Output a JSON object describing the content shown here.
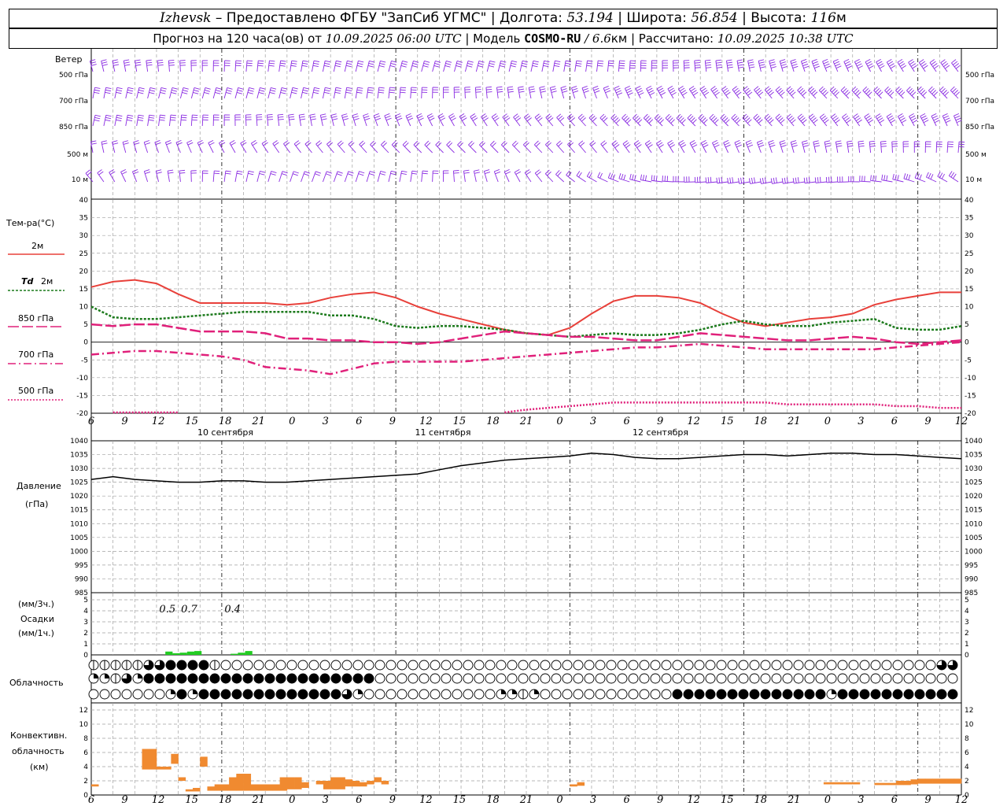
{
  "header": {
    "station": "Izhevsk",
    "dash": " – ",
    "provider": "Предоставлено ФГБУ \"ЗапСиб УГМС\" | Долгота: ",
    "lon": "53.194",
    "lat_label": " | Широта: ",
    "lat": "56.854",
    "alt_label": " | Высота: ",
    "alt": "116",
    "alt_unit": "м",
    "forecast_prefix": "Прогноз на 120 часа(ов) от ",
    "forecast_from": "10.09.2025 06:00 UTC",
    "model_label": " | Модель ",
    "model": "COSMO-RU",
    "model_res": " / 6.6",
    "model_unit": "км",
    "calc_label": " | Рассчитано: ",
    "calc": "10.09.2025 10:38 UTC"
  },
  "labels": {
    "wind": "Ветер",
    "wind_levels": [
      "500 гПа",
      "700 гПа",
      "850 гПа",
      "500 м",
      "10  м"
    ],
    "temp": "Тем-ра(°С)",
    "t2m": "2м",
    "td": "Td",
    "td2m": "2м",
    "t850": "850 гПа",
    "t700": "700 гПа",
    "t500": "500 гПа",
    "pressure": "Давление",
    "pressure_unit": "(гПа)",
    "precip_unit3": "(мм/3ч.)",
    "precip": "Осадки",
    "precip_unit1": "(мм/1ч.)",
    "cloud": "Облачность",
    "conv1": "Конвективн.",
    "conv2": "облачность",
    "conv3": "(км)"
  },
  "colors": {
    "t2m": "#e8403a",
    "td": "#1c7a1c",
    "t850": "#e0207a",
    "t700": "#e0207a",
    "t500": "#e0207a",
    "wind": "#8a2be2",
    "precip": "#22cc22",
    "conv": "#f08a30",
    "grid": "#a0a0a0"
  },
  "chart_data": [
    {
      "type": "line",
      "title": "Тем-ра(°С)",
      "x_ticks": [
        "6",
        "9",
        "12",
        "15",
        "18",
        "21",
        "0",
        "3",
        "6",
        "9",
        "12",
        "15",
        "18",
        "21",
        "0",
        "3",
        "6",
        "9",
        "12",
        "15",
        "18",
        "21",
        "0",
        "3",
        "6",
        "9",
        "12"
      ],
      "date_labels": [
        "10 сентября",
        "11 сентября",
        "12 сентября"
      ],
      "ylim": [
        -20,
        40
      ],
      "yticks": [
        -20,
        -15,
        -10,
        -5,
        0,
        5,
        10,
        15,
        20,
        25,
        30,
        35,
        40
      ],
      "x_hours": [
        0,
        3,
        6,
        9,
        12,
        15,
        18,
        21,
        24,
        27,
        30,
        33,
        36,
        39,
        42,
        45,
        48,
        51,
        54,
        57,
        60,
        63,
        66,
        69,
        72,
        75,
        78,
        81,
        84,
        87,
        90,
        93,
        96,
        99,
        102,
        105,
        108,
        111,
        114,
        117,
        120
      ],
      "series": [
        {
          "name": "2м",
          "values": [
            15.5,
            17,
            17.5,
            16.5,
            13.5,
            11,
            11,
            11,
            11,
            10.5,
            11,
            12.5,
            13.5,
            14,
            12.5,
            10,
            8,
            6.5,
            5,
            3.5,
            2.5,
            2,
            4,
            8,
            11.5,
            13,
            13,
            12.5,
            11,
            8,
            5.5,
            4.5,
            5.5,
            6.5,
            7,
            8,
            10.5,
            12,
            13,
            14,
            14
          ]
        },
        {
          "name": "Td 2м",
          "values": [
            10,
            7,
            6.5,
            6.5,
            7,
            7.5,
            8,
            8.5,
            8.5,
            8.5,
            8.5,
            7.5,
            7.5,
            6.5,
            4.5,
            4,
            4.5,
            4.5,
            4,
            3.5,
            2.5,
            2,
            1.5,
            2,
            2.5,
            2,
            2,
            2.5,
            3.5,
            5,
            6,
            5,
            4.5,
            4.5,
            5.5,
            6,
            6.5,
            4,
            3.5,
            3.5,
            4.5
          ]
        },
        {
          "name": "850 гПа",
          "values": [
            5,
            4.5,
            5,
            5,
            4,
            3,
            3,
            3,
            2.5,
            1,
            1,
            0.5,
            0.5,
            0,
            0,
            -0.5,
            0,
            1,
            2,
            3,
            2.5,
            2,
            1.5,
            1.5,
            1,
            0.5,
            0.5,
            1.5,
            2.5,
            2,
            1.5,
            1,
            0.5,
            0.5,
            1,
            1.5,
            1,
            0,
            -0.5,
            0,
            0.5
          ]
        },
        {
          "name": "700 гПа",
          "values": [
            -3.5,
            -3,
            -2.5,
            -2.5,
            -3,
            -3.5,
            -4,
            -5,
            -7,
            -7.5,
            -8,
            -9,
            -7.5,
            -6,
            -5.5,
            -5.5,
            -5.5,
            -5.5,
            -5,
            -4.5,
            -4,
            -3.5,
            -3,
            -2.5,
            -2,
            -1.5,
            -1.5,
            -1,
            -0.5,
            -1,
            -1.5,
            -2,
            -2,
            -2,
            -2,
            -2,
            -2,
            -1.5,
            -1,
            -0.5,
            0
          ]
        },
        {
          "name": "500 гПа",
          "values": [
            null,
            -20,
            -20,
            -20,
            -20,
            null,
            null,
            null,
            null,
            null,
            null,
            null,
            null,
            null,
            null,
            null,
            null,
            null,
            null,
            -20,
            -19,
            -18.5,
            -18,
            -17.5,
            -17,
            -17,
            -17,
            -17,
            -17,
            -17,
            -17,
            -17,
            -17.5,
            -17.5,
            -17.5,
            -17.5,
            -17.5,
            -18,
            -18,
            -18.5,
            -18.5
          ]
        }
      ]
    },
    {
      "type": "line",
      "title": "Давление",
      "ylabel": "(гПа)",
      "ylim": [
        985,
        1040
      ],
      "yticks": [
        985,
        990,
        995,
        1000,
        1005,
        1010,
        1015,
        1020,
        1025,
        1030,
        1035,
        1040
      ],
      "x_hours": [
        0,
        3,
        6,
        9,
        12,
        15,
        18,
        21,
        24,
        27,
        30,
        33,
        36,
        39,
        42,
        45,
        48,
        51,
        54,
        57,
        60,
        63,
        66,
        69,
        72,
        75,
        78,
        81,
        84,
        87,
        90,
        93,
        96,
        99,
        102,
        105,
        108,
        111,
        114,
        117,
        120
      ],
      "series": [
        {
          "name": "Давление",
          "values": [
            1026,
            1027,
            1026,
            1025.5,
            1025,
            1025,
            1025.5,
            1025.5,
            1025,
            1025,
            1025.5,
            1026,
            1026.5,
            1027,
            1027.5,
            1028,
            1029.5,
            1031,
            1032,
            1033,
            1033.5,
            1034,
            1034.5,
            1035.5,
            1035,
            1034,
            1033.5,
            1033.5,
            1034,
            1034.5,
            1035,
            1035,
            1034.5,
            1035,
            1035.5,
            1035.5,
            1035,
            1035,
            1034.5,
            1034,
            1033.5
          ]
        }
      ]
    },
    {
      "type": "bar",
      "title": "Осадки",
      "ylim": [
        0,
        5
      ],
      "yticks": [
        0,
        1,
        2,
        3,
        4,
        5
      ],
      "annotations": [
        {
          "hour": 10.5,
          "text": "0.5"
        },
        {
          "hour": 13.5,
          "text": "0.7"
        },
        {
          "hour": 19.5,
          "text": "0.4"
        }
      ],
      "hours": [
        10,
        11,
        12,
        13,
        14,
        19,
        20,
        21
      ],
      "values": [
        0.3,
        0.15,
        0.2,
        0.3,
        0.35,
        0.1,
        0.2,
        0.35
      ]
    },
    {
      "type": "bar",
      "title": "Конвективн. облачность (км)",
      "ylim": [
        0,
        13
      ],
      "yticks": [
        0,
        2,
        4,
        6,
        8,
        10,
        12
      ],
      "bars": [
        {
          "h": 0.5,
          "w": 1,
          "b": 1.2,
          "t": 1.5
        },
        {
          "h": 7.5,
          "w": 1,
          "b": 3.6,
          "t": 6.5
        },
        {
          "h": 8.5,
          "w": 1,
          "b": 3.6,
          "t": 6.5
        },
        {
          "h": 9.5,
          "w": 1,
          "b": 3.6,
          "t": 4
        },
        {
          "h": 10.5,
          "w": 1,
          "b": 3.6,
          "t": 4
        },
        {
          "h": 11.5,
          "w": 1,
          "b": 4.4,
          "t": 5.8
        },
        {
          "h": 12.5,
          "w": 1,
          "b": 2,
          "t": 2.5
        },
        {
          "h": 13.5,
          "w": 1,
          "b": 0.5,
          "t": 0.8
        },
        {
          "h": 14.5,
          "w": 1,
          "b": 0.5,
          "t": 1
        },
        {
          "h": 15.5,
          "w": 1,
          "b": 4,
          "t": 5.4
        },
        {
          "h": 16.5,
          "w": 1,
          "b": 0.6,
          "t": 1.2
        },
        {
          "h": 17.5,
          "w": 1,
          "b": 0.6,
          "t": 1.5
        },
        {
          "h": 18.5,
          "w": 1,
          "b": 0.6,
          "t": 1.5
        },
        {
          "h": 19.5,
          "w": 1,
          "b": 0.6,
          "t": 2.5
        },
        {
          "h": 20.5,
          "w": 1,
          "b": 0.6,
          "t": 3
        },
        {
          "h": 21.5,
          "w": 1,
          "b": 0.6,
          "t": 3
        },
        {
          "h": 22.5,
          "w": 1,
          "b": 0.6,
          "t": 1.5
        },
        {
          "h": 23.5,
          "w": 1,
          "b": 0.6,
          "t": 1.5
        },
        {
          "h": 24.5,
          "w": 1,
          "b": 0.6,
          "t": 1.5
        },
        {
          "h": 25.5,
          "w": 1,
          "b": 0.6,
          "t": 1.5
        },
        {
          "h": 26.5,
          "w": 1,
          "b": 0.6,
          "t": 2.5
        },
        {
          "h": 27.5,
          "w": 1,
          "b": 0.8,
          "t": 2.5
        },
        {
          "h": 28.5,
          "w": 1,
          "b": 0.8,
          "t": 2.5
        },
        {
          "h": 29.5,
          "w": 1,
          "b": 1,
          "t": 1.8
        },
        {
          "h": 31.5,
          "w": 1,
          "b": 1.5,
          "t": 2
        },
        {
          "h": 32.5,
          "w": 1,
          "b": 0.8,
          "t": 2
        },
        {
          "h": 33.5,
          "w": 1,
          "b": 0.8,
          "t": 2.5
        },
        {
          "h": 34.5,
          "w": 1,
          "b": 0.8,
          "t": 2.5
        },
        {
          "h": 35.5,
          "w": 1,
          "b": 1.2,
          "t": 2.2
        },
        {
          "h": 36.5,
          "w": 1,
          "b": 1.2,
          "t": 2
        },
        {
          "h": 37.5,
          "w": 1,
          "b": 1.2,
          "t": 1.8
        },
        {
          "h": 38.5,
          "w": 1,
          "b": 1.5,
          "t": 2
        },
        {
          "h": 39.5,
          "w": 1,
          "b": 1.8,
          "t": 2.5
        },
        {
          "h": 40.5,
          "w": 1,
          "b": 1.5,
          "t": 2
        },
        {
          "h": 66.5,
          "w": 1,
          "b": 1.2,
          "t": 1.5
        },
        {
          "h": 67.5,
          "w": 1,
          "b": 1.3,
          "t": 1.8
        },
        {
          "h": 101.5,
          "w": 1,
          "b": 1.5,
          "t": 1.8
        },
        {
          "h": 102.5,
          "w": 1,
          "b": 1.5,
          "t": 1.8
        },
        {
          "h": 103.5,
          "w": 1,
          "b": 1.5,
          "t": 1.8
        },
        {
          "h": 104.5,
          "w": 1,
          "b": 1.5,
          "t": 1.8
        },
        {
          "h": 105.5,
          "w": 1,
          "b": 1.5,
          "t": 1.8
        },
        {
          "h": 108.5,
          "w": 1,
          "b": 1.4,
          "t": 1.7
        },
        {
          "h": 109.5,
          "w": 1,
          "b": 1.4,
          "t": 1.7
        },
        {
          "h": 110.5,
          "w": 1,
          "b": 1.4,
          "t": 1.7
        },
        {
          "h": 111.5,
          "w": 1,
          "b": 1.4,
          "t": 2
        },
        {
          "h": 112.5,
          "w": 1,
          "b": 1.4,
          "t": 2
        },
        {
          "h": 113.5,
          "w": 1,
          "b": 1.5,
          "t": 2.2
        },
        {
          "h": 114.5,
          "w": 1,
          "b": 1.6,
          "t": 2.3
        },
        {
          "h": 115.5,
          "w": 1,
          "b": 1.6,
          "t": 2.3
        },
        {
          "h": 116.5,
          "w": 1,
          "b": 1.6,
          "t": 2.3
        },
        {
          "h": 117.5,
          "w": 1,
          "b": 1.6,
          "t": 2.3
        },
        {
          "h": 118.5,
          "w": 1,
          "b": 1.6,
          "t": 2.3
        },
        {
          "h": 119.5,
          "w": 1,
          "b": 1.6,
          "t": 2.3
        }
      ]
    },
    {
      "type": "table",
      "title": "Облачность",
      "note": "cloud cover symbols per hour: 0=clear,1=few,2=scattered,3=broken,4=overcast",
      "rows": [
        [
          1,
          1,
          1,
          1,
          1,
          1,
          1,
          2,
          3,
          3,
          4,
          4,
          4,
          4,
          4,
          4,
          1,
          1,
          0,
          0,
          0,
          0,
          0,
          0,
          0,
          0,
          0,
          0,
          0,
          0,
          0,
          0,
          0,
          0,
          0,
          0,
          0,
          0,
          0,
          0,
          0,
          0,
          0,
          0,
          0,
          0,
          0,
          0,
          0,
          0,
          0,
          0,
          0,
          0,
          0,
          0,
          0,
          0,
          0,
          0,
          0,
          0,
          0,
          0,
          0,
          0,
          0,
          0,
          0,
          0,
          0,
          0,
          0,
          0,
          0,
          0,
          0,
          0,
          0,
          0,
          0,
          0,
          0,
          0,
          0,
          0,
          0,
          0,
          0,
          0,
          0,
          0,
          0,
          0,
          0,
          0,
          0,
          0,
          0,
          0,
          0,
          0,
          0,
          0,
          0,
          0,
          0,
          0,
          0,
          0,
          0,
          0,
          0,
          0,
          0,
          0,
          3,
          4,
          3
        ],
        [
          2,
          3,
          2,
          1,
          2,
          3,
          2,
          3,
          4,
          4,
          4,
          4,
          4,
          4,
          4,
          4,
          4,
          4,
          4,
          4,
          4,
          4,
          4,
          4,
          4,
          4,
          4,
          4,
          4,
          4,
          4,
          4,
          4,
          4,
          4,
          4,
          4,
          4,
          4,
          3,
          0,
          0,
          0,
          0,
          0,
          0,
          0,
          0,
          0,
          0,
          0,
          0,
          0,
          0,
          0,
          0,
          0,
          0,
          0,
          0,
          0,
          0,
          0,
          0,
          0,
          0,
          0,
          0,
          0,
          0,
          0,
          0,
          0,
          0,
          0,
          0,
          0,
          0,
          0,
          0,
          0,
          0,
          0,
          0,
          0,
          0,
          0,
          0,
          0,
          0,
          0,
          0,
          0,
          0,
          0,
          0,
          0,
          0,
          0,
          0,
          0,
          0,
          0,
          0,
          0,
          0,
          0,
          0,
          0,
          0,
          0,
          0,
          0,
          0,
          0,
          0,
          0,
          0,
          0,
          0
        ],
        [
          0,
          0,
          0,
          0,
          0,
          0,
          0,
          0,
          0,
          0,
          0,
          2,
          4,
          4,
          2,
          4,
          4,
          4,
          4,
          4,
          4,
          4,
          4,
          4,
          4,
          4,
          4,
          4,
          4,
          4,
          4,
          4,
          4,
          4,
          4,
          3,
          3,
          2,
          0,
          1,
          0,
          0,
          0,
          0,
          0,
          0,
          0,
          0,
          0,
          0,
          0,
          0,
          0,
          0,
          1,
          0,
          2,
          3,
          2,
          2,
          1,
          2,
          0,
          0,
          0,
          0,
          0,
          0,
          0,
          0,
          0,
          3,
          0,
          0,
          0,
          0,
          0,
          0,
          0,
          0,
          3,
          4,
          4,
          4,
          4,
          4,
          4,
          4,
          4,
          4,
          4,
          4,
          4,
          4,
          4,
          4,
          4,
          4,
          4,
          4,
          4,
          4,
          2,
          4,
          4,
          4,
          4,
          4,
          4,
          4,
          4,
          4,
          4,
          4,
          4,
          4,
          4,
          4,
          4,
          4
        ]
      ]
    }
  ]
}
